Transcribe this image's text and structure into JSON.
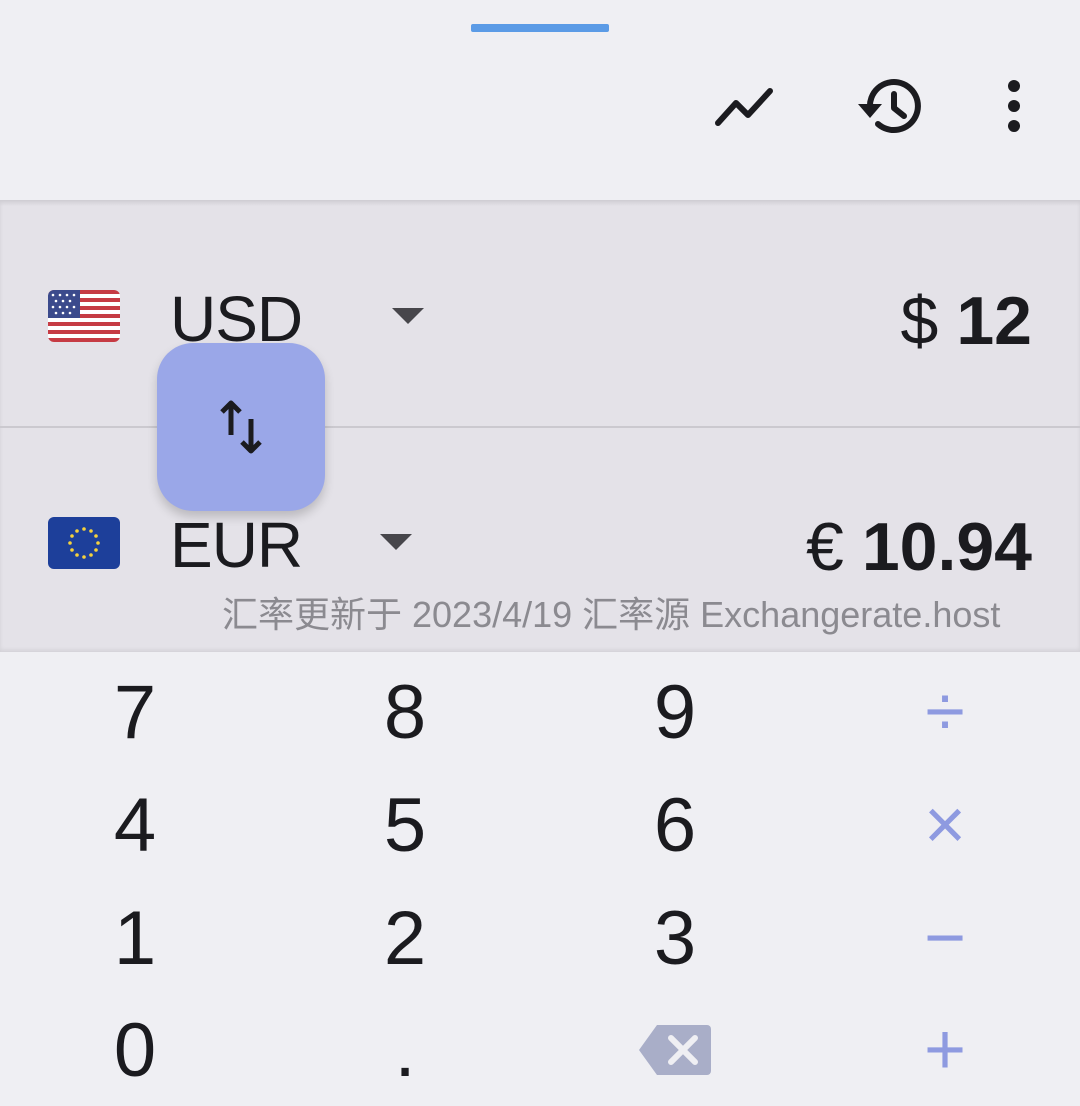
{
  "toolbar": {
    "chart_icon": "trending-icon",
    "history_icon": "history-icon",
    "menu_icon": "more-vert-icon"
  },
  "converter": {
    "from": {
      "code": "USD",
      "symbol": "$",
      "amount": "12",
      "flag": "us-flag"
    },
    "to": {
      "code": "EUR",
      "symbol": "€",
      "amount": "10.94",
      "flag": "eu-flag"
    },
    "note": "汇率更新于 2023/4/19 汇率源 Exchangerate.host"
  },
  "keypad": {
    "rows": [
      [
        "7",
        "8",
        "9",
        "÷"
      ],
      [
        "4",
        "5",
        "6",
        "×"
      ],
      [
        "1",
        "2",
        "3",
        "−"
      ],
      [
        "0",
        ".",
        "backspace",
        "+"
      ]
    ]
  },
  "colors": {
    "accent": "#9aa7e8",
    "operator": "#8e9ae0",
    "handle": "#5b9be6",
    "background": "#efeff3",
    "panel": "#e4e2e8"
  }
}
